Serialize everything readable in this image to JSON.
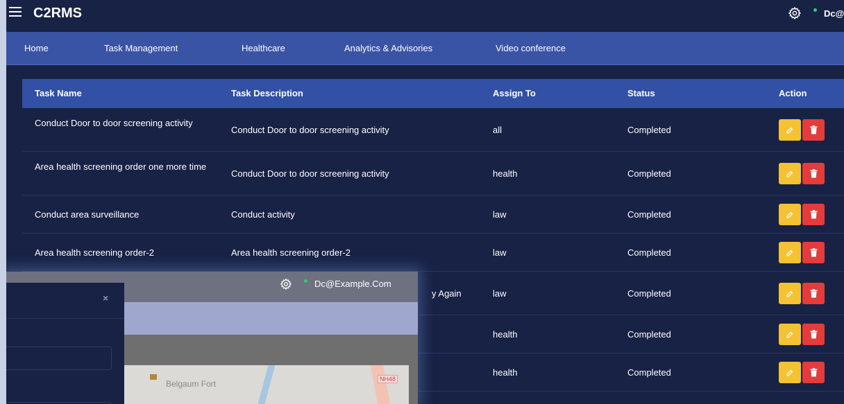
{
  "app": {
    "title": "C2RMS",
    "user_email": "Dc@",
    "accent": "#3150a6"
  },
  "nav": {
    "items": [
      {
        "label": "Home"
      },
      {
        "label": "Task Management"
      },
      {
        "label": "Healthcare"
      },
      {
        "label": "Analytics & Advisories"
      },
      {
        "label": "Video conference"
      }
    ]
  },
  "table": {
    "headers": {
      "name": "Task Name",
      "description": "Task Description",
      "assign_to": "Assign To",
      "status": "Status",
      "action": "Action"
    },
    "rows": [
      {
        "name": "Conduct Door to door screening activity",
        "description": "Conduct Door to door screening activity",
        "assign_to": "all",
        "status": "Completed"
      },
      {
        "name": "Area health screening order one more time",
        "description": "Conduct Door to door screening activity",
        "assign_to": "health",
        "status": "Completed"
      },
      {
        "name": "Conduct area surveillance",
        "description": "Conduct activity",
        "assign_to": "law",
        "status": "Completed"
      },
      {
        "name": "Area health screening order-2",
        "description": "Area health screening order-2",
        "assign_to": "law",
        "status": "Completed"
      },
      {
        "name": "",
        "description": "",
        "assign_to": "law",
        "status": "Completed"
      },
      {
        "name": "",
        "description": "",
        "assign_to": "health",
        "status": "Completed"
      },
      {
        "name": "",
        "description": "",
        "assign_to": "health",
        "status": "Completed"
      }
    ],
    "edit_color": "#f4c233",
    "delete_color": "#e43b3b"
  },
  "overlay": {
    "user_email": "Dc@Example.Com",
    "partial_text": "y Again",
    "map_label": "Belgaum Fort",
    "map_road_badge": "NH48",
    "close_glyph": "×"
  }
}
